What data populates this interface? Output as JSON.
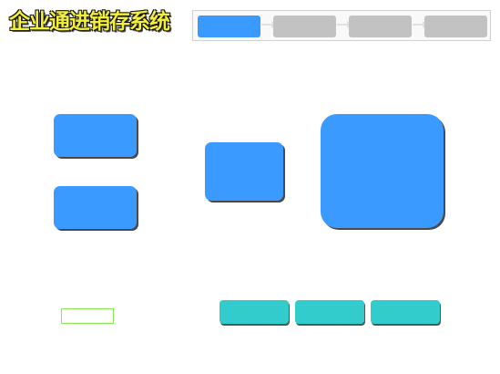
{
  "header": {
    "app_title": "企业通进销存系统"
  },
  "steps": [
    {
      "state": "done"
    },
    {
      "state": "todo"
    },
    {
      "state": "todo"
    },
    {
      "state": "todo"
    }
  ],
  "colors": {
    "tile_blue": "#3a9aff",
    "step_pending_gray": "#c2c2c2",
    "teal_button": "#33cccc",
    "title_yellow": "#f2ee3a",
    "slot_border_green": "#86e84c"
  }
}
